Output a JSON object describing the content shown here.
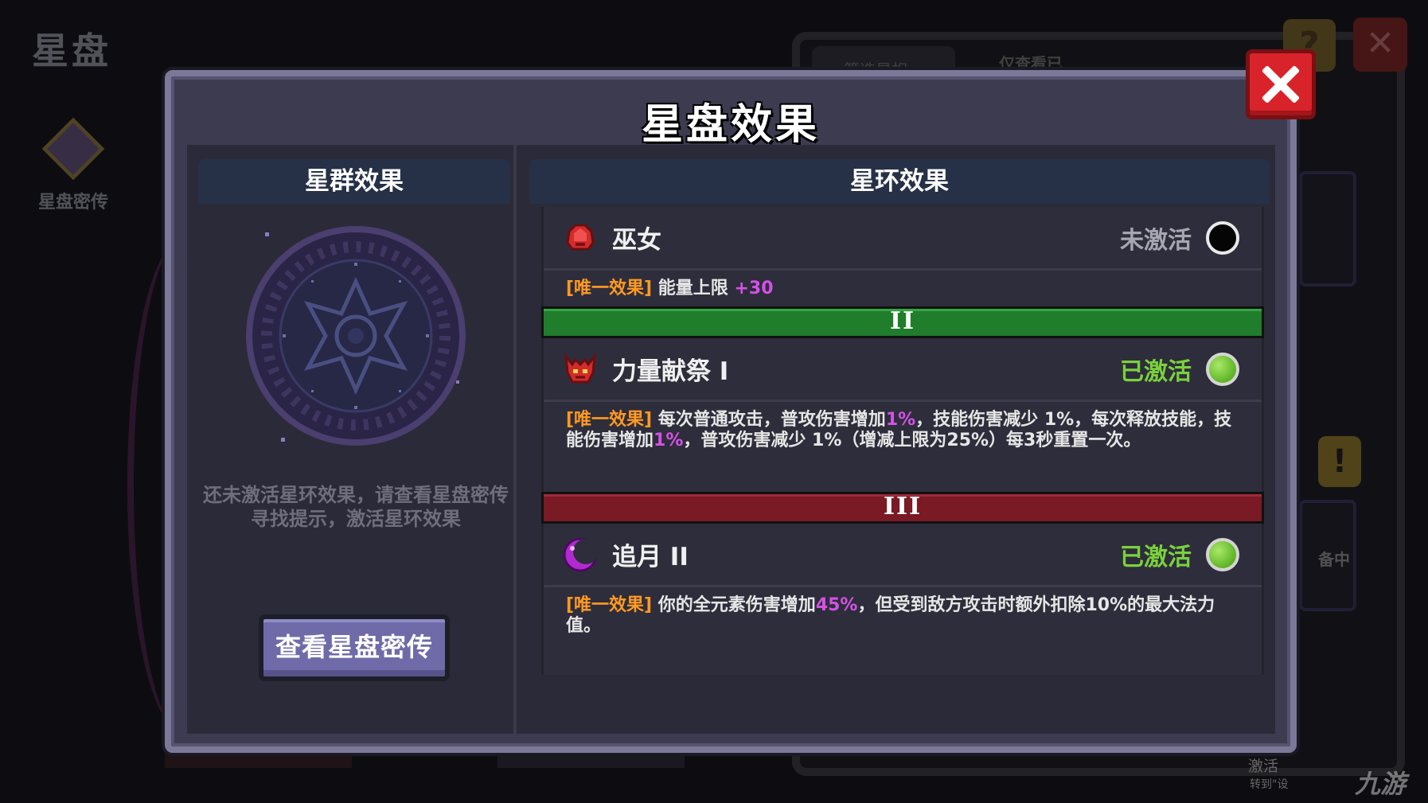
{
  "background": {
    "screen_title": "星盘",
    "sidebar_item_label": "星盘密传",
    "right_tab_1": "筛选星相",
    "right_tab_2": "仅查看已",
    "card_text": "备中",
    "help_glyph": "?",
    "close_glyph": "✕",
    "warning_glyph": "!",
    "bottom_text_1": "激活",
    "bottom_text_2": "转到\"设",
    "watermark": "九游"
  },
  "modal": {
    "title": "星盘效果",
    "left": {
      "header": "星群效果",
      "description": "还未激活星环效果，请查看星盘密传寻找提示，激活星环效果",
      "button_label": "查看星盘密传"
    },
    "right": {
      "header": "星环效果",
      "effects": [
        {
          "name": "巫女",
          "status": "未激活",
          "active": false,
          "icon": "red-helmet-icon",
          "tag": "[唯一效果]",
          "desc_parts": [
            "能量上限 ",
            "+30"
          ]
        },
        {
          "tier": "II",
          "name": "力量献祭 I",
          "status": "已激活",
          "active": true,
          "icon": "red-demon-icon",
          "tag": "[唯一效果]",
          "desc_parts": [
            "每次普通攻击，普攻伤害增加",
            "1%",
            "，技能伤害减少 1%，每次释放技能，技能伤害增加",
            "1%",
            "，普攻伤害减少 1%（增减上限为25%）每3秒重置一次。"
          ]
        },
        {
          "tier": "III",
          "name": "追月 II",
          "status": "已激活",
          "active": true,
          "icon": "purple-moon-icon",
          "tag": "[唯一效果]",
          "desc_parts": [
            "你的全元素伤害增加",
            "45%",
            "，但受到敌方攻击时额外扣除10%的最大法力值。"
          ]
        }
      ]
    }
  },
  "colors": {
    "tag_orange": "#ff9a22",
    "value_purple": "#d451e6",
    "active_green": "#7ad13c",
    "tier2_green": "#1f7d2c",
    "tier3_red": "#7a1a24",
    "close_red": "#d9232a"
  }
}
